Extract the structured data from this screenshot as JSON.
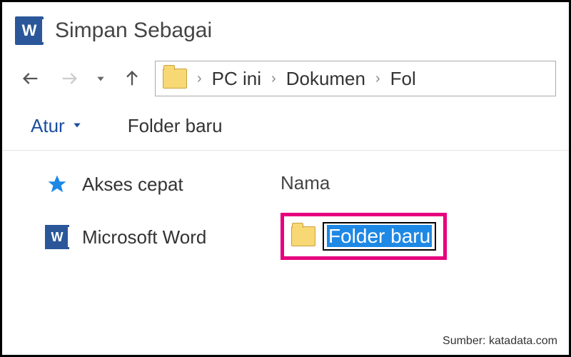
{
  "titlebar": {
    "title": "Simpan Sebagai"
  },
  "breadcrumb": {
    "items": [
      "PC ini",
      "Dokumen",
      "Fol"
    ]
  },
  "toolbar": {
    "organize_label": "Atur",
    "new_folder_label": "Folder baru"
  },
  "sidebar": {
    "quick_access": "Akses cepat",
    "word": "Microsoft Word"
  },
  "column_header": "Nama",
  "rename_value": "Folder baru",
  "source_label": "Sumber: katadata.com"
}
